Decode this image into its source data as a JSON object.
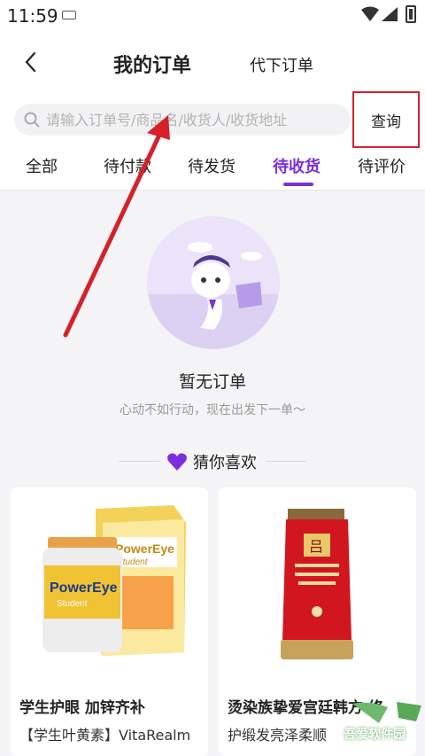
{
  "status_bar": {
    "time": "11:59"
  },
  "header": {
    "back_icon": "chevron-left-icon",
    "title": "我的订单",
    "subtitle": "代下订单"
  },
  "search": {
    "placeholder": "请输入订单号/商品名/收货人/收货地址",
    "button_label": "查询"
  },
  "tabs": [
    {
      "label": "全部"
    },
    {
      "label": "待付款"
    },
    {
      "label": "待发货"
    },
    {
      "label": "待收货",
      "active": true
    },
    {
      "label": "待评价"
    }
  ],
  "empty_state": {
    "title": "暂无订单",
    "subtitle": "心动不如行动，现在出发下一单～"
  },
  "recommend": {
    "title": "猜你喜欢",
    "icon": "heart-icon"
  },
  "products": [
    {
      "name": "学生护眼 加锌齐补",
      "desc": "【学生叶黄素】VitaRealm",
      "brand_text": "PowerEye",
      "brand_sub": "Student"
    },
    {
      "name": "烫染族挚爱宫廷韩方 修",
      "desc": "护缎发亮泽柔顺",
      "brand_text": "吕"
    }
  ],
  "watermark": {
    "text": "吾爱软件园"
  },
  "colors": {
    "accent": "#7b2ee0",
    "highlight_box": "#d6212a",
    "arrow": "#d6212a"
  }
}
